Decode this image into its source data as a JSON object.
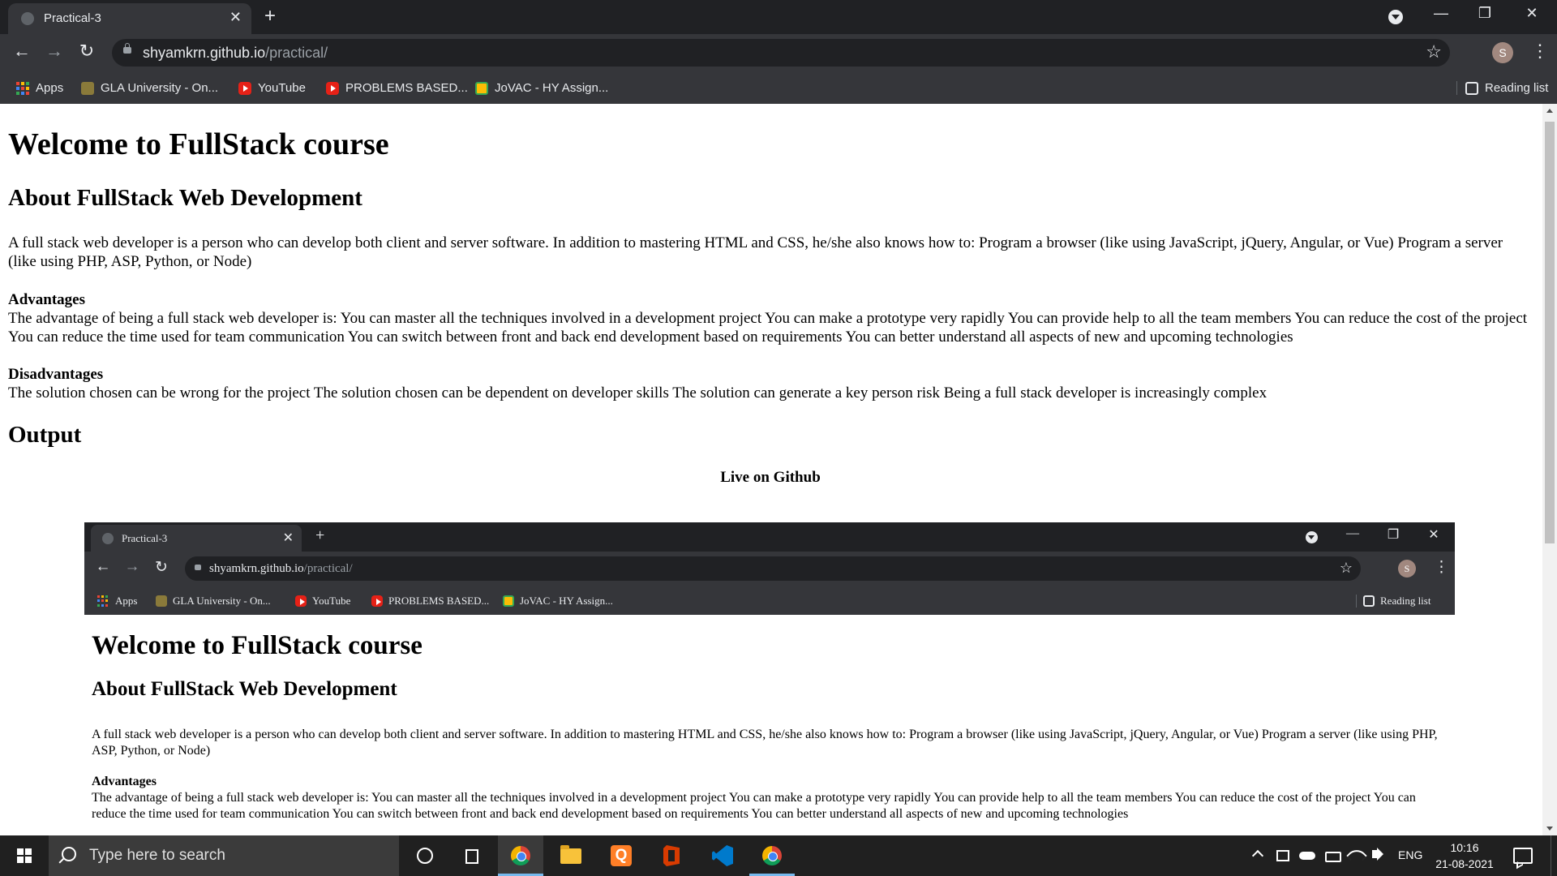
{
  "browser": {
    "tab_title": "Practical-3",
    "tab_close": "✕",
    "new_tab": "+",
    "url_host": "shyamkrn.github.io",
    "url_path": "/practical/",
    "profile_initial": "S",
    "window": {
      "minimize": "—",
      "restore": "❐",
      "close": "✕"
    },
    "nav": {
      "back": "←",
      "forward": "→",
      "reload": "↻"
    },
    "star": "☆",
    "menu": "⋮",
    "bookmarks": [
      {
        "label": "Apps",
        "icon": "apps-grid-icon"
      },
      {
        "label": "GLA University - On...",
        "icon": "gla-logo-icon"
      },
      {
        "label": "YouTube",
        "icon": "youtube-icon"
      },
      {
        "label": "PROBLEMS BASED...",
        "icon": "youtube-icon"
      },
      {
        "label": "JoVAC - HY Assign...",
        "icon": "classroom-icon"
      }
    ],
    "reading_list": "Reading list"
  },
  "page": {
    "title": "Welcome to FullStack course",
    "about_heading": "About FullStack Web Development",
    "intro": "A full stack web developer is a person who can develop both client and server software. In addition to mastering HTML and CSS, he/she also knows how to: Program a browser (like using JavaScript, jQuery, Angular, or Vue) Program a server (like using PHP, ASP, Python, or Node)",
    "advantages_label": "Advantages",
    "advantages_text": "The advantage of being a full stack web developer is: You can master all the techniques involved in a development project You can make a prototype very rapidly You can provide help to all the team members You can reduce the cost of the project You can reduce the time used for team communication You can switch between front and back end development based on requirements You can better understand all aspects of new and upcoming technologies",
    "disadvantages_label": "Disadvantages",
    "disadvantages_text": "The solution chosen can be wrong for the project The solution chosen can be dependent on developer skills The solution can generate a key person risk Being a full stack developer is increasingly complex",
    "output_heading": "Output",
    "live_label": "Live on Github"
  },
  "taskbar": {
    "search_placeholder": "Type here to search",
    "apps": [
      "task-view",
      "chrome",
      "file-explorer",
      "q-app",
      "office",
      "vscode",
      "chrome-profile"
    ],
    "language": "ENG",
    "time": "10:16",
    "date": "21-08-2021"
  },
  "colors": {
    "tabstrip": "#202124",
    "toolbar": "#35363a",
    "taskbar": "#202020",
    "accent": "#76b9ed"
  }
}
